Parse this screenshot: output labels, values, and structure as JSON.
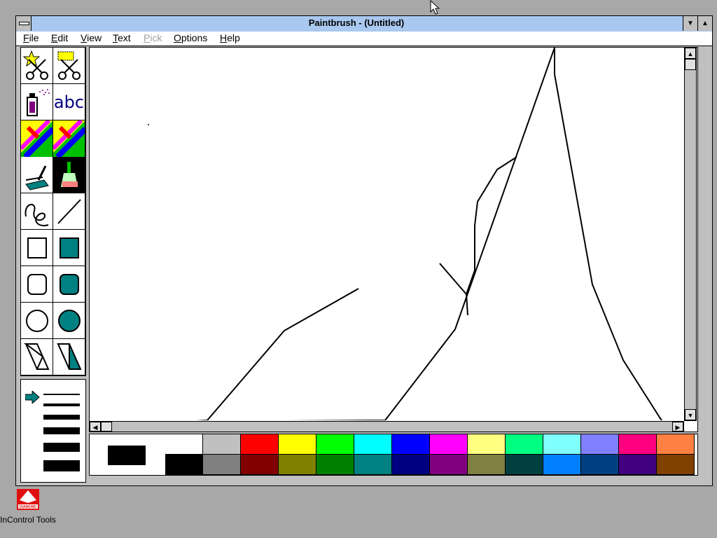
{
  "window": {
    "title": "Paintbrush - (Untitled)",
    "minimize_glyph": "▼",
    "maximize_glyph": "▲"
  },
  "menu": [
    {
      "label": "File",
      "underline": "F",
      "rest": "ile",
      "enabled": true
    },
    {
      "label": "Edit",
      "underline": "E",
      "rest": "dit",
      "enabled": true
    },
    {
      "label": "View",
      "underline": "V",
      "rest": "iew",
      "enabled": true
    },
    {
      "label": "Text",
      "underline": "T",
      "rest": "ext",
      "enabled": true
    },
    {
      "label": "Pick",
      "underline": "P",
      "rest": "ick",
      "enabled": false
    },
    {
      "label": "Options",
      "underline": "O",
      "rest": "ptions",
      "enabled": true
    },
    {
      "label": "Help",
      "underline": "H",
      "rest": "elp",
      "enabled": true
    }
  ],
  "tools": [
    {
      "name": "scissors-cutout",
      "icon": "scissors-star-icon"
    },
    {
      "name": "pick",
      "icon": "scissors-rect-icon"
    },
    {
      "name": "airbrush",
      "icon": "airbrush-icon"
    },
    {
      "name": "text",
      "icon": "text-abc-icon",
      "text": "abc"
    },
    {
      "name": "color-eraser",
      "icon": "color-eraser-icon"
    },
    {
      "name": "eraser",
      "icon": "eraser-icon"
    },
    {
      "name": "paint-roller",
      "icon": "paint-roller-icon"
    },
    {
      "name": "brush",
      "icon": "brush-icon",
      "selected": true
    },
    {
      "name": "curve",
      "icon": "curve-icon"
    },
    {
      "name": "line",
      "icon": "line-icon"
    },
    {
      "name": "box",
      "icon": "box-icon"
    },
    {
      "name": "filled-box",
      "icon": "filled-box-icon"
    },
    {
      "name": "rounded-box",
      "icon": "rounded-box-icon"
    },
    {
      "name": "filled-rounded-box",
      "icon": "filled-rounded-box-icon"
    },
    {
      "name": "circle",
      "icon": "circle-icon"
    },
    {
      "name": "filled-circle",
      "icon": "filled-circle-icon"
    },
    {
      "name": "polygon",
      "icon": "polygon-icon"
    },
    {
      "name": "filled-polygon",
      "icon": "filled-polygon-icon"
    }
  ],
  "line_widths": {
    "count": 6,
    "selected_index": 0
  },
  "palette": {
    "foreground": "#000000",
    "background": "#ffffff",
    "top_row": [
      "#ffffff",
      "#c0c0c0",
      "#ff0000",
      "#ffff00",
      "#00ff00",
      "#00ffff",
      "#0000ff",
      "#ff00ff",
      "#ffff80",
      "#00ff80",
      "#80ffff",
      "#8080ff",
      "#ff0080",
      "#ff8040"
    ],
    "bottom_row": [
      "#000000",
      "#808080",
      "#800000",
      "#808000",
      "#008000",
      "#008080",
      "#000080",
      "#800080",
      "#808040",
      "#004040",
      "#0080ff",
      "#004080",
      "#400080",
      "#804000"
    ]
  },
  "desktop_icon": {
    "label": "InControl Tools",
    "logo_text": "DIAMOND",
    "icon": "diamond-logo-icon"
  }
}
